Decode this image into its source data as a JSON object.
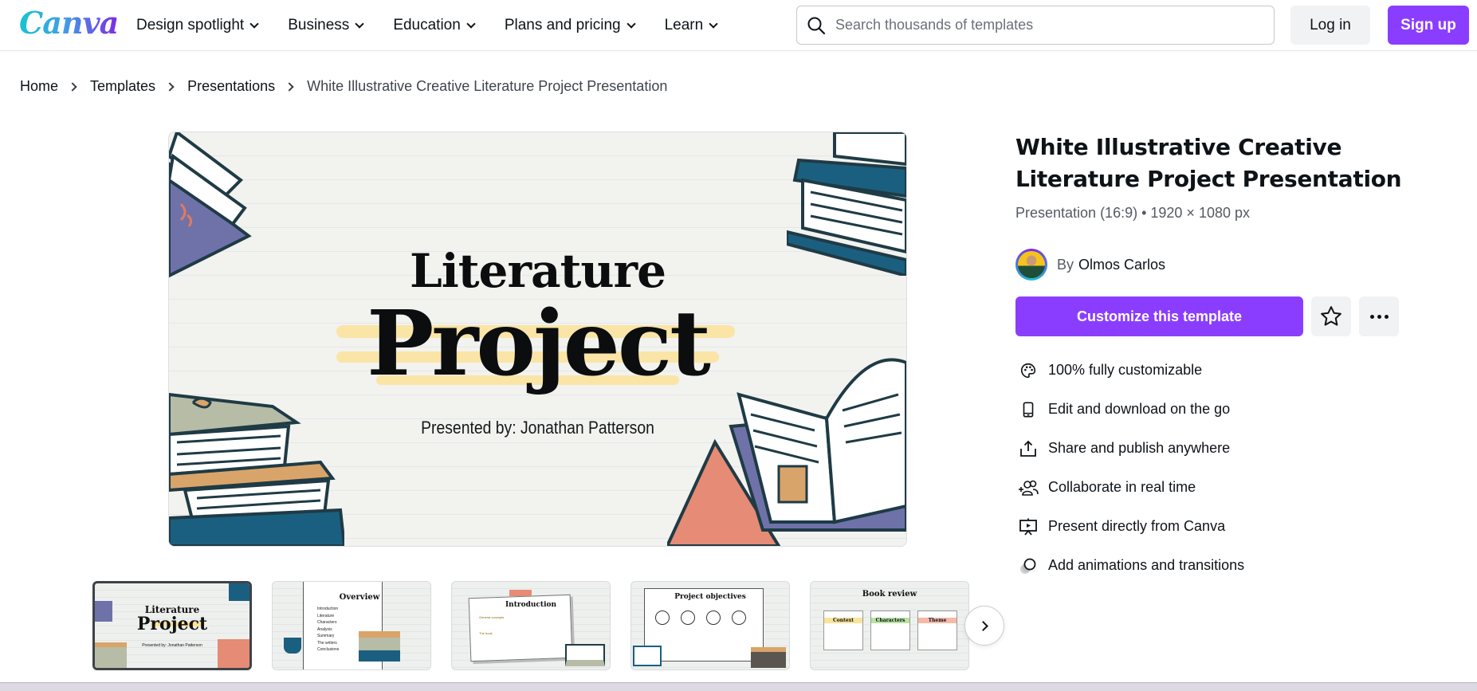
{
  "header": {
    "logo": "Canva",
    "nav": [
      {
        "label": "Design spotlight"
      },
      {
        "label": "Business"
      },
      {
        "label": "Education"
      },
      {
        "label": "Plans and pricing"
      },
      {
        "label": "Learn"
      }
    ],
    "search": {
      "placeholder": "Search thousands of templates",
      "value": ""
    },
    "login_label": "Log in",
    "signup_label": "Sign up"
  },
  "breadcrumb": {
    "items": [
      "Home",
      "Templates",
      "Presentations"
    ],
    "current": "White Illustrative Creative Literature Project Presentation"
  },
  "preview": {
    "title_line1": "Literature",
    "title_line2": "Project",
    "subtitle": "Presented by: Jonathan Patterson"
  },
  "template": {
    "title": "White Illustrative Creative Literature Project Presentation",
    "meta": "Presentation (16:9) • 1920 × 1080 px",
    "by_label": "By",
    "author": "Olmos Carlos",
    "customize_label": "Customize this template",
    "features": [
      {
        "icon": "palette-icon",
        "label": "100% fully customizable"
      },
      {
        "icon": "phone-icon",
        "label": "Edit and download on the go"
      },
      {
        "icon": "share-icon",
        "label": "Share and publish anywhere"
      },
      {
        "icon": "collaborate-icon",
        "label": "Collaborate in real time"
      },
      {
        "icon": "present-icon",
        "label": "Present directly from Canva"
      },
      {
        "icon": "animation-icon",
        "label": "Add animations and transitions"
      }
    ]
  },
  "thumbnails": [
    {
      "title": "Literature Project",
      "subtitle": "Presented by: Jonathan Patterson"
    },
    {
      "title": "Overview",
      "items": [
        "Introduction",
        "Literature",
        "Characters",
        "Analysis",
        "Summary",
        "The writers",
        "Conclusions"
      ]
    },
    {
      "title": "Introduction",
      "items": [
        "General concepts",
        "The book"
      ]
    },
    {
      "title": "Project objectives"
    },
    {
      "title": "Book review",
      "items": [
        "Context",
        "Characters",
        "Theme"
      ]
    }
  ],
  "colors": {
    "brand_purple": "#8b3dff",
    "text": "#0e1318",
    "muted": "#545a63"
  }
}
